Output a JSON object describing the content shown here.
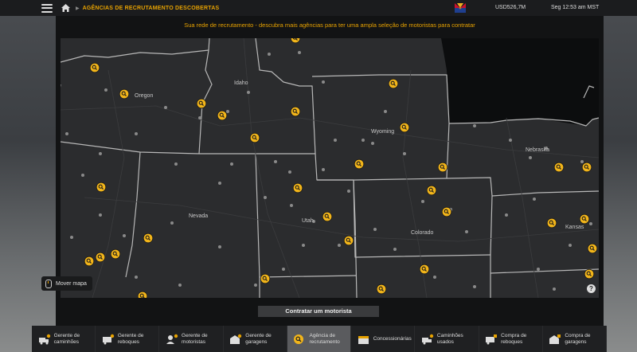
{
  "topbar": {
    "breadcrumb": "AGÊNCIAS DE RECRUTAMENTO DESCOBERTAS",
    "money": "USD526,7M",
    "time": "Seg 12:53 am MST"
  },
  "panel": {
    "subtitle": "Sua rede de recrutamento - descubra mais agências para ter uma ampla seleção de motoristas para contratar"
  },
  "map": {
    "states": [
      "Oregon",
      "Idaho",
      "Wyoming",
      "Nebraska",
      "Nevada",
      "Utah",
      "Colorado",
      "Kansas"
    ],
    "move_hint": "Mover mapa",
    "help_icon": "help-icon"
  },
  "actions": {
    "hire_label": "Contratar um motorista"
  },
  "bottom_menu": [
    {
      "label": "Gerente de caminhões",
      "icon": "truck-gear-icon"
    },
    {
      "label": "Gerente de reboques",
      "icon": "trailer-gear-icon"
    },
    {
      "label": "Gerente de motoristas",
      "icon": "driver-gear-icon"
    },
    {
      "label": "Gerente de garagens",
      "icon": "garage-gear-icon"
    },
    {
      "label": "Agência de recrutamento",
      "icon": "recruitment-agency-icon",
      "active": true
    },
    {
      "label": "Concessionárias",
      "icon": "dealership-icon"
    },
    {
      "label": "Caminhões usados",
      "icon": "used-truck-icon"
    },
    {
      "label": "Compra de reboques",
      "icon": "buy-trailer-icon"
    },
    {
      "label": "Compra de garagens",
      "icon": "buy-garage-icon"
    }
  ],
  "colors": {
    "accent": "#e6a100",
    "panel": "#121314",
    "topbar": "#1b1c1e",
    "map_land": "#2b2c2e"
  }
}
